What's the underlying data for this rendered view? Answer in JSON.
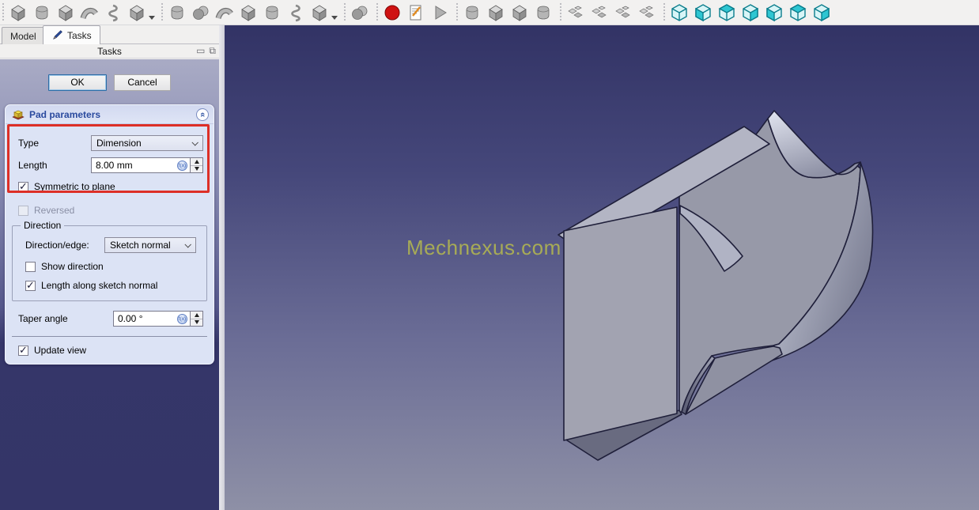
{
  "toolbar": {
    "groups": [
      {
        "name": "partdesign-additive",
        "icons": [
          "pad-icon",
          "revolution-icon",
          "additive-loft-icon",
          "additive-pipe-icon",
          "additive-helix-icon",
          "additive-primitive-icon"
        ],
        "has_dropdown": true
      },
      {
        "name": "partdesign-subtractive",
        "icons": [
          "pocket-icon",
          "hole-icon",
          "groove-icon",
          "subtractive-pipe-icon",
          "subtractive-loft-icon",
          "subtractive-helix-icon",
          "subtractive-primitive-icon"
        ],
        "has_dropdown": true
      },
      {
        "name": "boolean",
        "icons": [
          "boolean-operation-icon"
        ]
      },
      {
        "name": "macro",
        "icons": [
          "macro-record-icon",
          "macro-edit-icon",
          "macro-execute-icon"
        ]
      },
      {
        "name": "dressup",
        "icons": [
          "fillet-icon",
          "chamfer-icon",
          "draft-icon",
          "thickness-icon"
        ]
      },
      {
        "name": "pattern",
        "icons": [
          "mirrored-icon",
          "linear-pattern-icon",
          "polar-pattern-icon",
          "multitransform-icon"
        ]
      },
      {
        "name": "views",
        "icons": [
          "view-axonometric-icon",
          "view-front-icon",
          "view-top-icon",
          "view-right-icon",
          "view-rear-icon",
          "view-bottom-icon",
          "view-left-icon"
        ]
      }
    ]
  },
  "tabs": {
    "model": "Model",
    "tasks": "Tasks"
  },
  "panel": {
    "title": "Tasks",
    "ok_label": "OK",
    "cancel_label": "Cancel"
  },
  "task_box": {
    "title": "Pad parameters",
    "type": {
      "label": "Type",
      "value": "Dimension"
    },
    "length": {
      "label": "Length",
      "value": "8.00 mm"
    },
    "symmetric": {
      "label": "Symmetric to plane",
      "checked": true
    },
    "reversed": {
      "label": "Reversed",
      "checked": false,
      "enabled": false
    },
    "direction": {
      "legend": "Direction",
      "edge": {
        "label": "Direction/edge:",
        "value": "Sketch normal"
      },
      "show_direction": {
        "label": "Show direction",
        "checked": false
      },
      "length_along": {
        "label": "Length along sketch normal",
        "checked": true
      }
    },
    "taper": {
      "label": "Taper angle",
      "value": "0.00 °"
    },
    "update_view": {
      "label": "Update view",
      "checked": true
    }
  },
  "viewport": {
    "watermark": "Mechnexus.com",
    "highlight_color": "#dd2f27",
    "accent_teal": "#2ec6d2",
    "part_color": "#9799a8"
  }
}
